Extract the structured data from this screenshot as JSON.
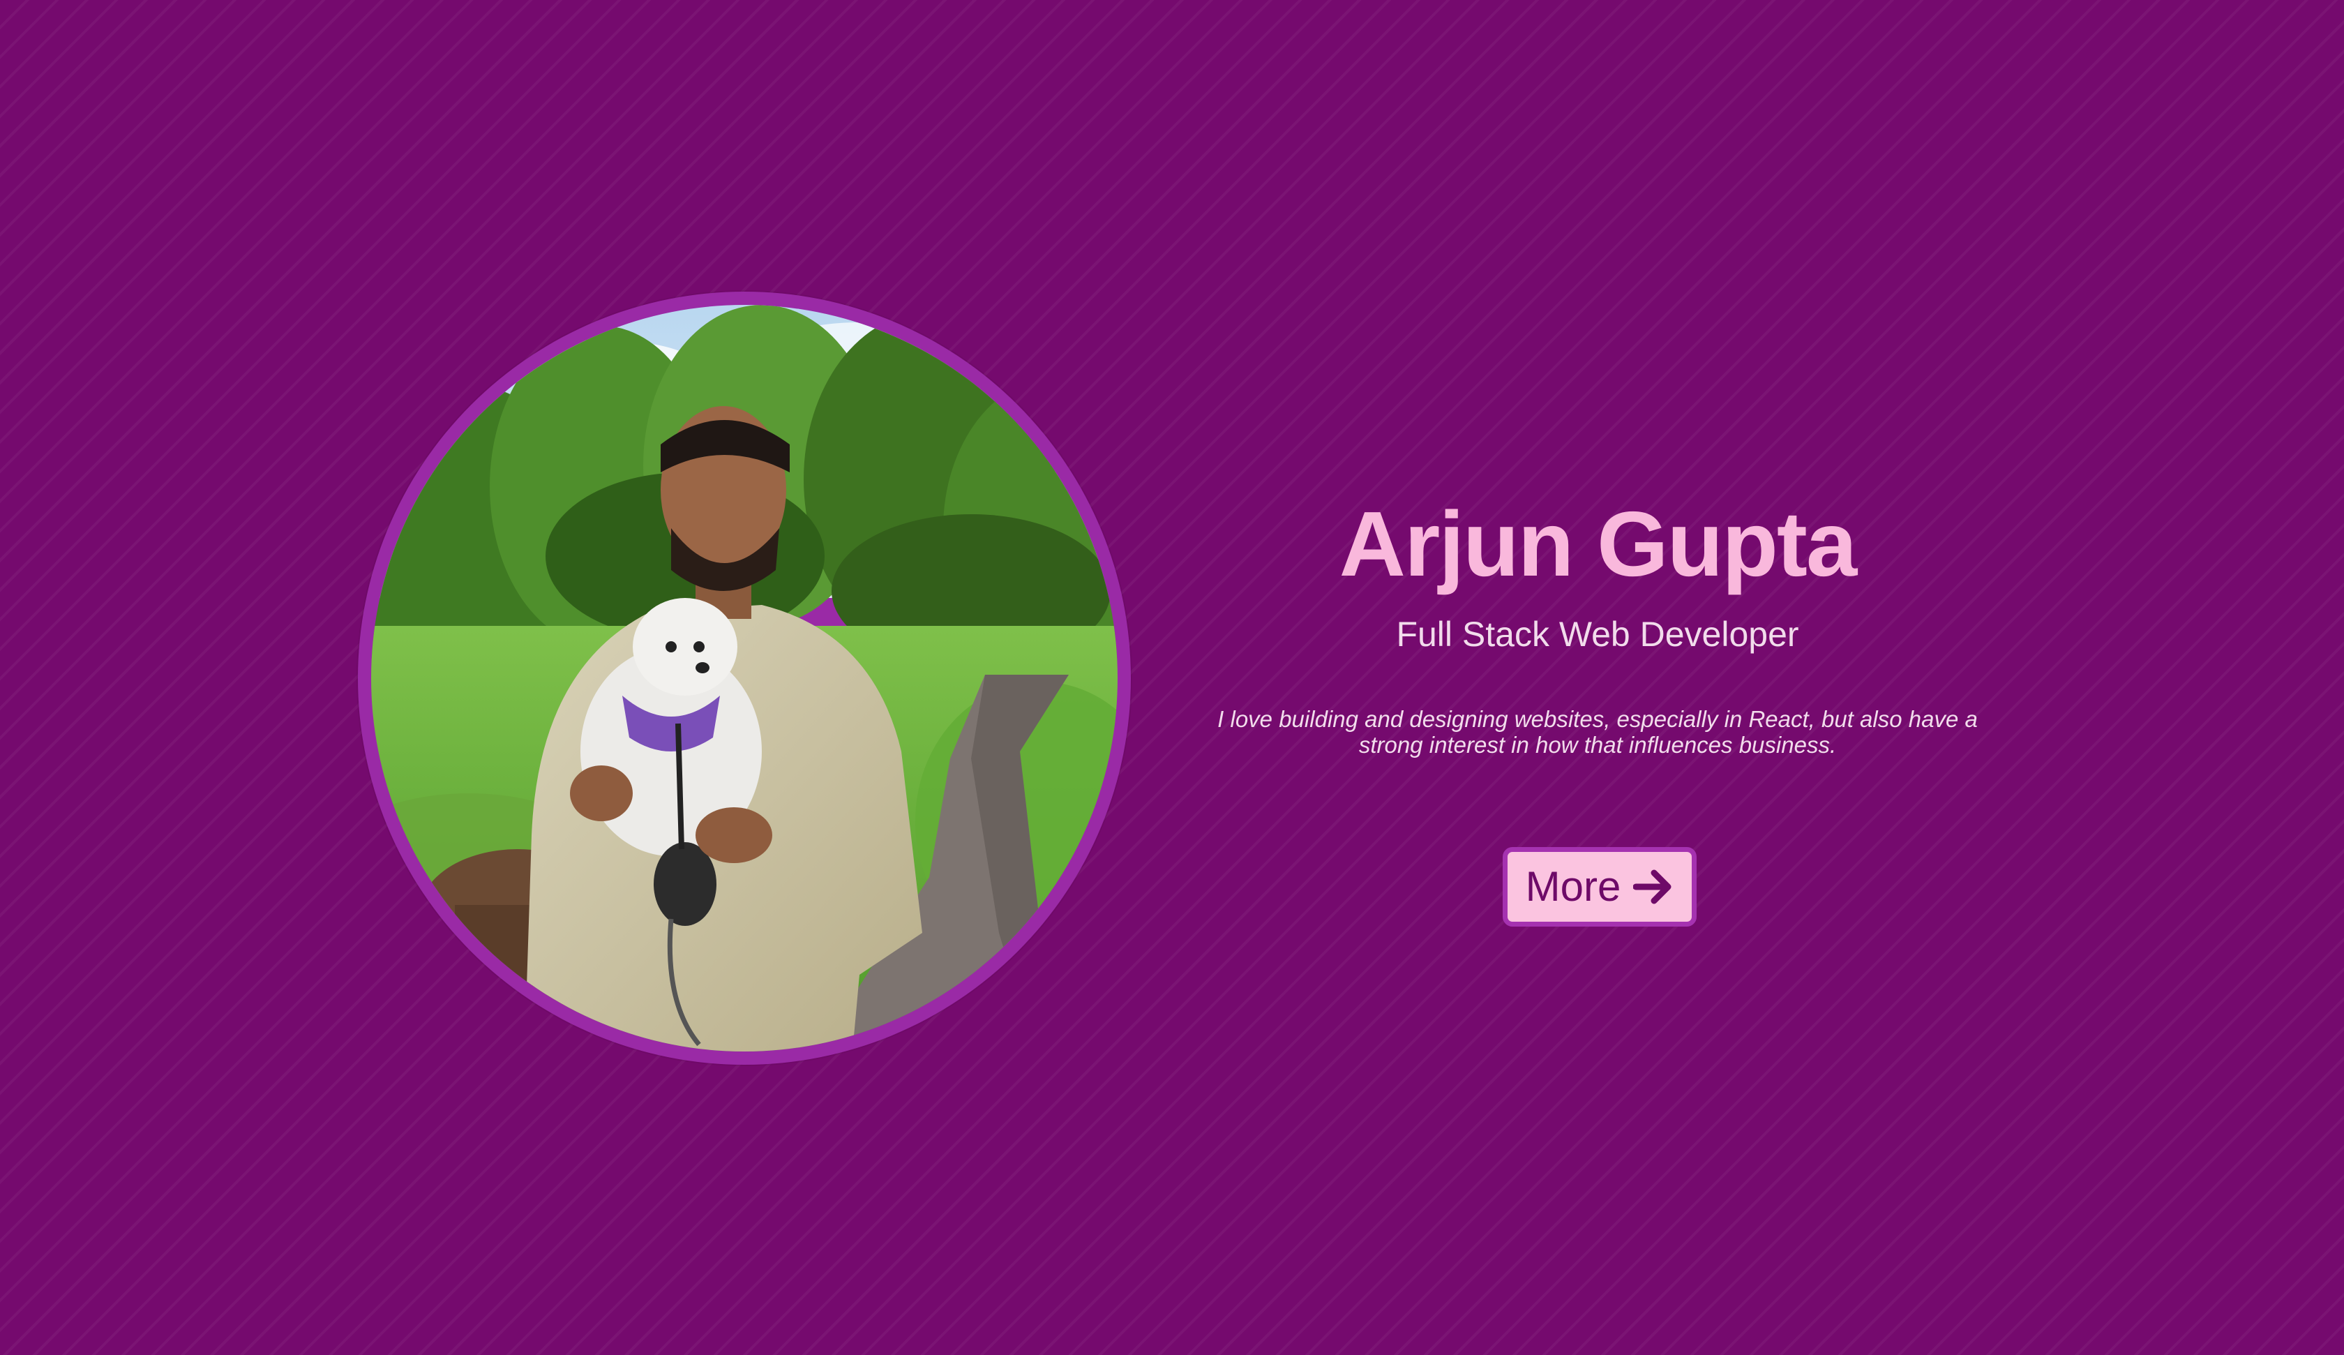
{
  "profile": {
    "name": "Arjun Gupta",
    "role": "Full Stack Web Developer",
    "bio": "I love building and designing websites, especially in React, but also have a strong interest in how that influences business.",
    "more_label": "More",
    "photo_icon": "portrait-photo",
    "more_icon": "arrow-right-icon"
  },
  "colors": {
    "background": "#750a6e",
    "ring": "#9a2aa6",
    "accent": "#f9b8dc",
    "button_bg": "#fbc4e0",
    "button_text": "#6e0a68"
  }
}
